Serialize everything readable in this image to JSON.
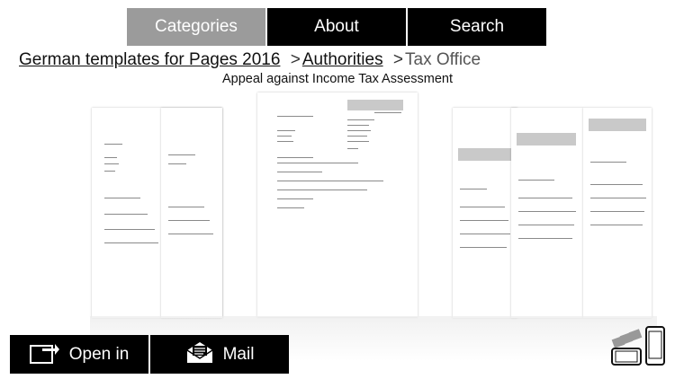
{
  "tabs": [
    {
      "label": "Categories",
      "active": true
    },
    {
      "label": "About",
      "active": false
    },
    {
      "label": "Search",
      "active": false
    }
  ],
  "breadcrumb": {
    "root": "German templates for Pages 2016",
    "separator": ">",
    "level1": "Authorities",
    "current": "Tax Office"
  },
  "document_title": "Appeal against Income Tax Assessment",
  "actions": {
    "open_in": "Open in",
    "mail": "Mail"
  },
  "icons": {
    "open_in": "open-in-icon",
    "mail": "mail-icon",
    "zoom": "zoom-icon"
  },
  "colors": {
    "tab_active": "#9b9b9b",
    "tab": "#000000",
    "text": "#111111"
  }
}
